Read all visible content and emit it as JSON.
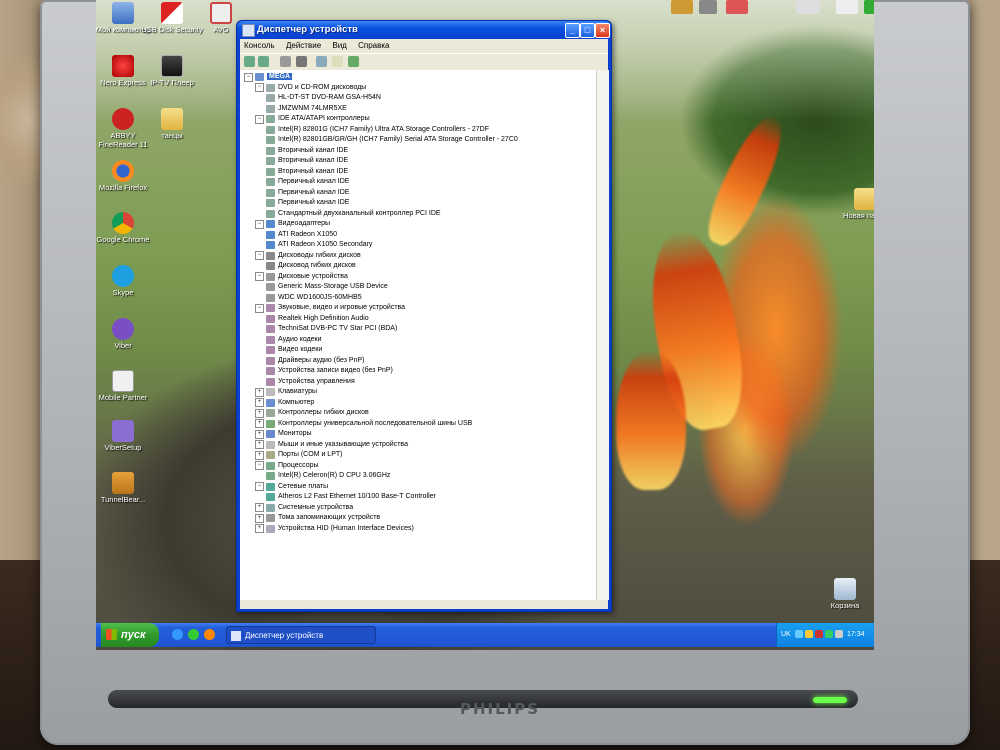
{
  "desktop": {
    "icons_left": [
      {
        "label": "Мой компьютер",
        "icon": "my-computer-icon"
      },
      {
        "label": "USB Disk Security",
        "icon": "usb-security-icon"
      },
      {
        "label": "AVG",
        "icon": "avg-icon"
      },
      {
        "label": "Nero Express",
        "icon": "nero-icon"
      },
      {
        "label": "IP-TV Плеер",
        "icon": "iptv-icon"
      },
      {
        "label": "ABBYY FineReader 11",
        "icon": "abbyy-icon"
      },
      {
        "label": "танцы",
        "icon": "folder-icon"
      },
      {
        "label": "Mozilla Firefox",
        "icon": "firefox-icon"
      },
      {
        "label": "Google Chrome",
        "icon": "chrome-icon"
      },
      {
        "label": "Skype",
        "icon": "skype-icon"
      },
      {
        "label": "Viber",
        "icon": "viber-icon"
      },
      {
        "label": "Mobile Partner",
        "icon": "mobile-partner-icon"
      },
      {
        "label": "ViberSetup",
        "icon": "viber-setup-icon"
      },
      {
        "label": "TunnelBear...",
        "icon": "tunnelbear-icon"
      }
    ],
    "icons_right": [
      {
        "label": "Новая папка",
        "icon": "folder-icon"
      },
      {
        "label": "Корзина",
        "icon": "recycle-bin-icon"
      }
    ]
  },
  "window": {
    "title": "Диспетчер устройств",
    "menu": [
      "Консоль",
      "Действие",
      "Вид",
      "Справка"
    ],
    "toolbar": [
      "back-icon",
      "forward-icon",
      "properties-icon",
      "print-icon",
      "refresh-icon",
      "help-icon",
      "scan-icon"
    ],
    "tree": [
      {
        "level": 0,
        "label": "MEGA",
        "expander": "−",
        "icon": "computer-icon",
        "root": true
      },
      {
        "level": 1,
        "label": "DVD и CD-ROM дисководы",
        "expander": "−",
        "icon": "dvd-drive-icon"
      },
      {
        "level": 2,
        "label": "HL-DT-ST DVD-RAM GSA-H54N",
        "icon": "dvd-drive-icon"
      },
      {
        "level": 2,
        "label": "JMZWNM 74LMR5XE",
        "icon": "dvd-drive-icon"
      },
      {
        "level": 1,
        "label": "IDE ATA/ATAPI контроллеры",
        "expander": "−",
        "icon": "ide-controller-icon"
      },
      {
        "level": 2,
        "label": "Intel(R) 82801G (ICH7 Family) Ultra ATA Storage Controllers - 27DF",
        "icon": "ide-controller-icon"
      },
      {
        "level": 2,
        "label": "Intel(R) 82801GB/GR/GH (ICH7 Family) Serial ATA Storage Controller - 27C0",
        "icon": "ide-controller-icon"
      },
      {
        "level": 2,
        "label": "Вторичный канал IDE",
        "icon": "ide-controller-icon"
      },
      {
        "level": 2,
        "label": "Вторичный канал IDE",
        "icon": "ide-controller-icon"
      },
      {
        "level": 2,
        "label": "Вторичный канал IDE",
        "icon": "ide-controller-icon"
      },
      {
        "level": 2,
        "label": "Первичный канал IDE",
        "icon": "ide-controller-icon"
      },
      {
        "level": 2,
        "label": "Первичный канал IDE",
        "icon": "ide-controller-icon"
      },
      {
        "level": 2,
        "label": "Первичный канал IDE",
        "icon": "ide-controller-icon"
      },
      {
        "level": 2,
        "label": "Стандартный двухканальный контроллер PCI IDE",
        "icon": "ide-controller-icon"
      },
      {
        "level": 1,
        "label": "Видеоадаптеры",
        "expander": "−",
        "icon": "display-adapter-icon"
      },
      {
        "level": 2,
        "label": "ATI Radeon X1050",
        "icon": "display-adapter-icon"
      },
      {
        "level": 2,
        "label": "ATI Radeon X1050 Secondary",
        "icon": "display-adapter-icon"
      },
      {
        "level": 1,
        "label": "Дисководы гибких дисков",
        "expander": "−",
        "icon": "floppy-icon"
      },
      {
        "level": 2,
        "label": "Дисковод гибких дисков",
        "icon": "floppy-icon"
      },
      {
        "level": 1,
        "label": "Дисковые устройства",
        "expander": "−",
        "icon": "disk-drive-icon"
      },
      {
        "level": 2,
        "label": "Generic Mass-Storage USB Device",
        "icon": "disk-drive-icon"
      },
      {
        "level": 2,
        "label": "WDC WD1600JS-60MHB5",
        "icon": "disk-drive-icon"
      },
      {
        "level": 1,
        "label": "Звуковые, видео и игровые устройства",
        "expander": "−",
        "icon": "sound-icon"
      },
      {
        "level": 2,
        "label": "Realtek High Definition Audio",
        "icon": "sound-icon"
      },
      {
        "level": 2,
        "label": "TechniSat DVB-PC TV Star PCI (BDA)",
        "icon": "sound-icon"
      },
      {
        "level": 2,
        "label": "Аудио кодеки",
        "icon": "sound-icon"
      },
      {
        "level": 2,
        "label": "Видео кодеки",
        "icon": "sound-icon"
      },
      {
        "level": 2,
        "label": "Драйверы аудио (без PnP)",
        "icon": "sound-icon"
      },
      {
        "level": 2,
        "label": "Устройства записи видео (без PnP)",
        "icon": "sound-icon"
      },
      {
        "level": 2,
        "label": "Устройства управления",
        "icon": "sound-icon"
      },
      {
        "level": 1,
        "label": "Клавиатуры",
        "expander": "+",
        "icon": "keyboard-icon"
      },
      {
        "level": 1,
        "label": "Компьютер",
        "expander": "+",
        "icon": "computer-icon"
      },
      {
        "level": 1,
        "label": "Контроллеры гибких дисков",
        "expander": "+",
        "icon": "floppy-controller-icon"
      },
      {
        "level": 1,
        "label": "Контроллеры универсальной последовательной шины USB",
        "expander": "+",
        "icon": "usb-icon"
      },
      {
        "level": 1,
        "label": "Мониторы",
        "expander": "+",
        "icon": "monitor-icon"
      },
      {
        "level": 1,
        "label": "Мыши и иные указывающие устройства",
        "expander": "+",
        "icon": "mouse-icon"
      },
      {
        "level": 1,
        "label": "Порты (COM и LPT)",
        "expander": "+",
        "icon": "port-icon"
      },
      {
        "level": 1,
        "label": "Процессоры",
        "expander": "−",
        "icon": "processor-icon"
      },
      {
        "level": 2,
        "label": "Intel(R) Celeron(R) D CPU 3.06GHz",
        "icon": "processor-icon"
      },
      {
        "level": 1,
        "label": "Сетевые платы",
        "expander": "−",
        "icon": "network-adapter-icon"
      },
      {
        "level": 2,
        "label": "Atheros L2 Fast Ethernet 10/100 Base-T Controller",
        "icon": "network-adapter-icon"
      },
      {
        "level": 1,
        "label": "Системные устройства",
        "expander": "+",
        "icon": "system-device-icon"
      },
      {
        "level": 1,
        "label": "Тома запоминающих устройств",
        "expander": "+",
        "icon": "volume-icon"
      },
      {
        "level": 1,
        "label": "Устройства HID (Human Interface Devices)",
        "expander": "+",
        "icon": "hid-icon"
      }
    ]
  },
  "taskbar": {
    "start_label": "пуск",
    "task_label": "Диспетчер устройств",
    "tray_lang": "UK",
    "clock": "17:34"
  },
  "monitor": {
    "brand": "PHILIPS"
  }
}
